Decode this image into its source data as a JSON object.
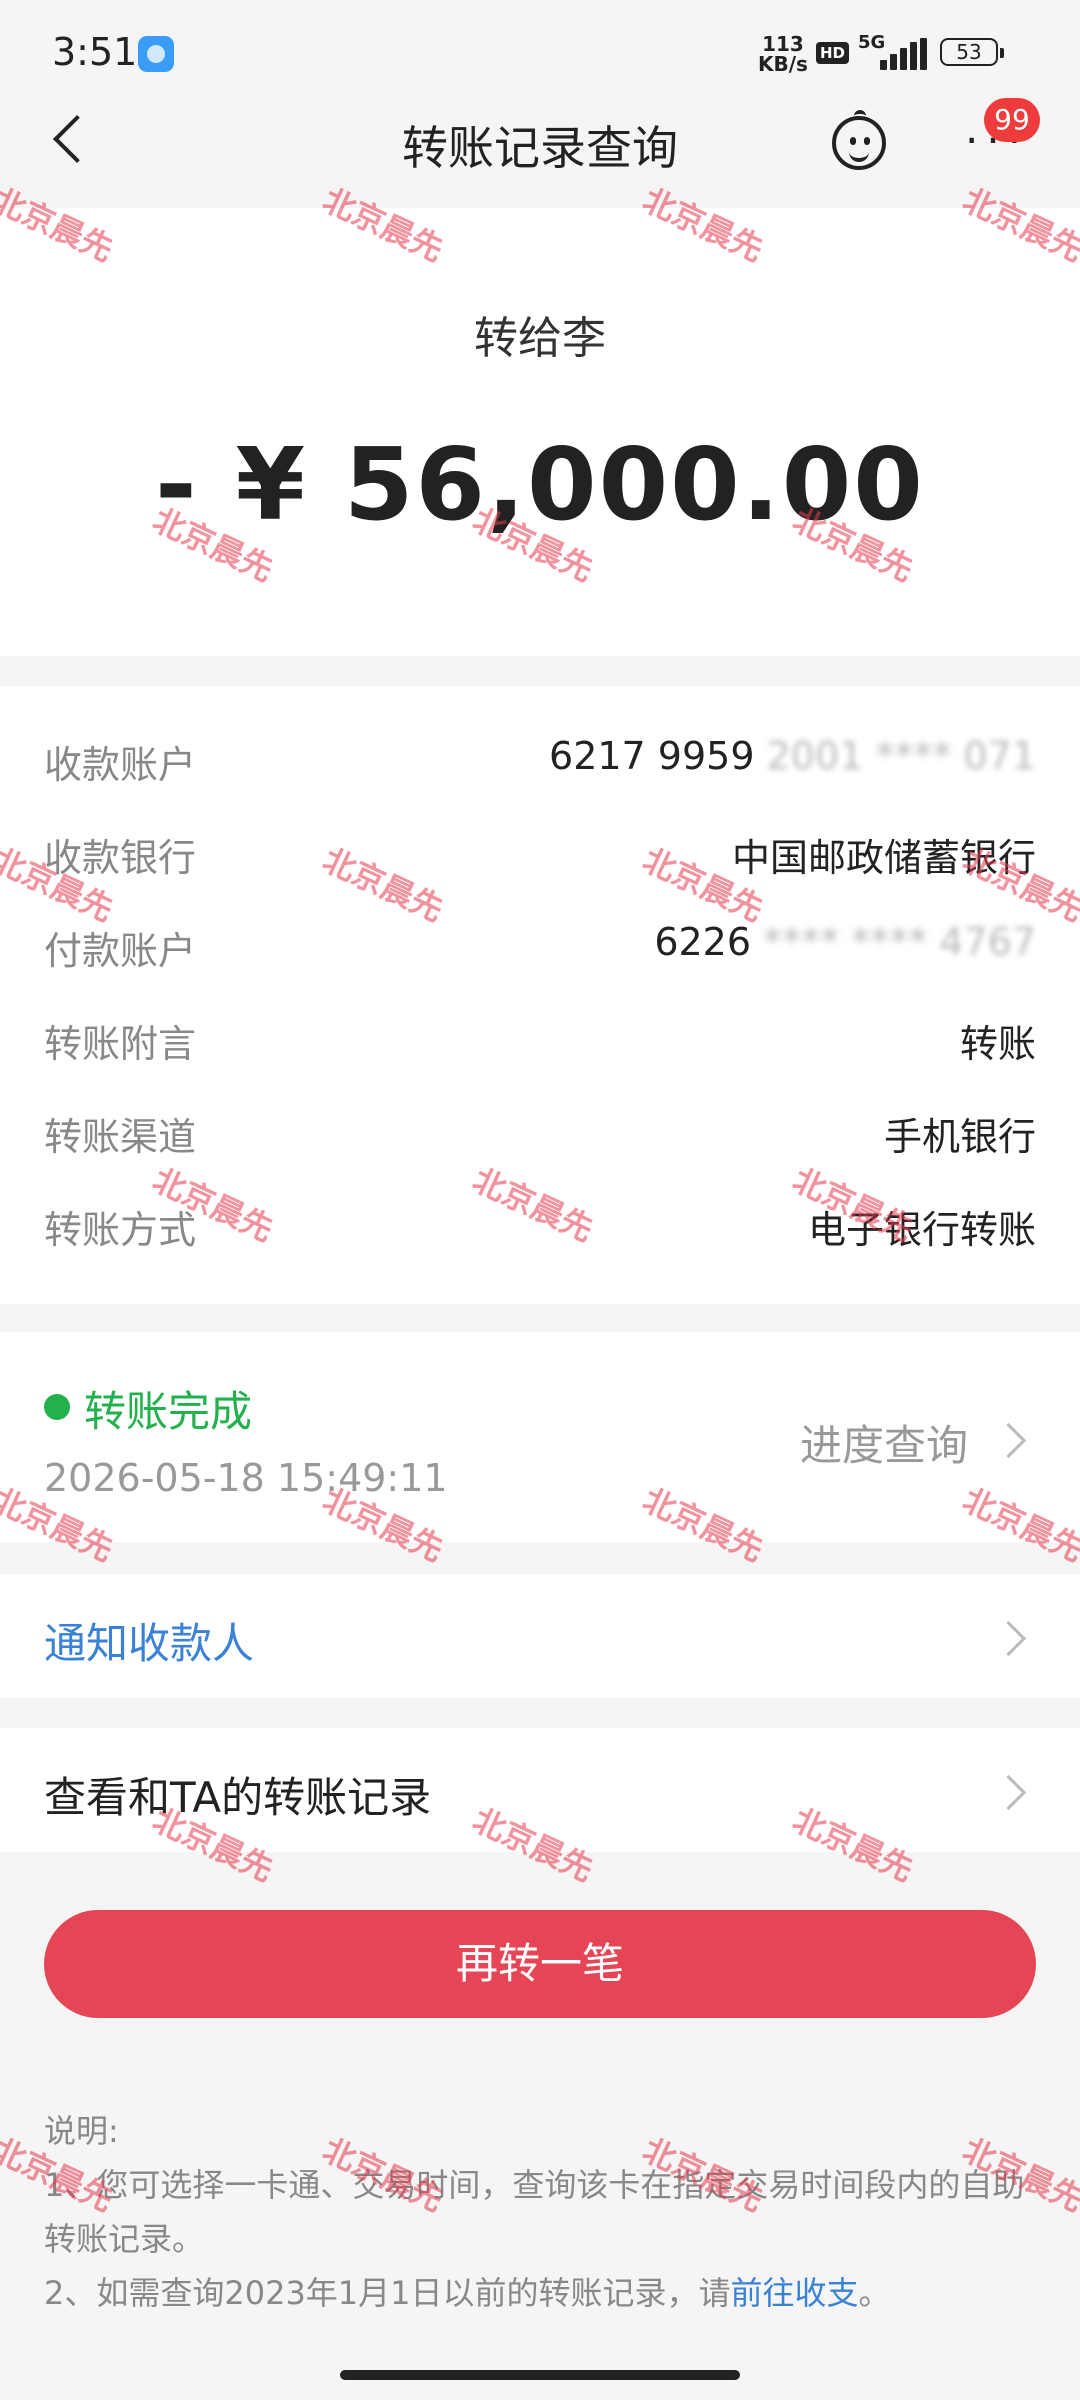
{
  "status_bar": {
    "time": "3:51",
    "net_speed_value": "113",
    "net_speed_unit": "KB/s",
    "hd": "HD",
    "network": "5G",
    "battery": "53"
  },
  "nav": {
    "title": "转账记录查询",
    "badge": "99"
  },
  "transfer": {
    "recipient": "转给李",
    "amount": "- ¥ 56,000.00"
  },
  "details": [
    {
      "label": "收款账户",
      "value": "6217 9959",
      "value_blurred": " 2001 **** 071"
    },
    {
      "label": "收款银行",
      "value": "中国邮政储蓄银行",
      "value_blurred": ""
    },
    {
      "label": "付款账户",
      "value": "6226",
      "value_blurred": " **** **** 4767"
    },
    {
      "label": "转账附言",
      "value": "转账",
      "value_blurred": ""
    },
    {
      "label": "转账渠道",
      "value": "手机银行",
      "value_blurred": ""
    },
    {
      "label": "转账方式",
      "value": "电子银行转账",
      "value_blurred": ""
    }
  ],
  "status": {
    "text": "转账完成",
    "datetime": "2026-05-18 15:49:11",
    "progress_link": "进度查询"
  },
  "actions": {
    "notify": "通知收款人",
    "history": "查看和TA的转账记录",
    "again_button": "再转一笔"
  },
  "notes": {
    "heading": "说明:",
    "line1": "1、您可选择一卡通、交易时间，查询该卡在指定交易时间段内的自助转账记录。",
    "line2_prefix": "2、如需查询2023年1月1日以前的转账记录，请",
    "line2_link": "前往收支",
    "line2_suffix": "。"
  },
  "watermark_text": "北京晨先",
  "colors": {
    "accent_red": "#e64555",
    "success_green": "#22b14c",
    "link_blue": "#3b82d6",
    "badge_red": "#ee3c3c"
  }
}
